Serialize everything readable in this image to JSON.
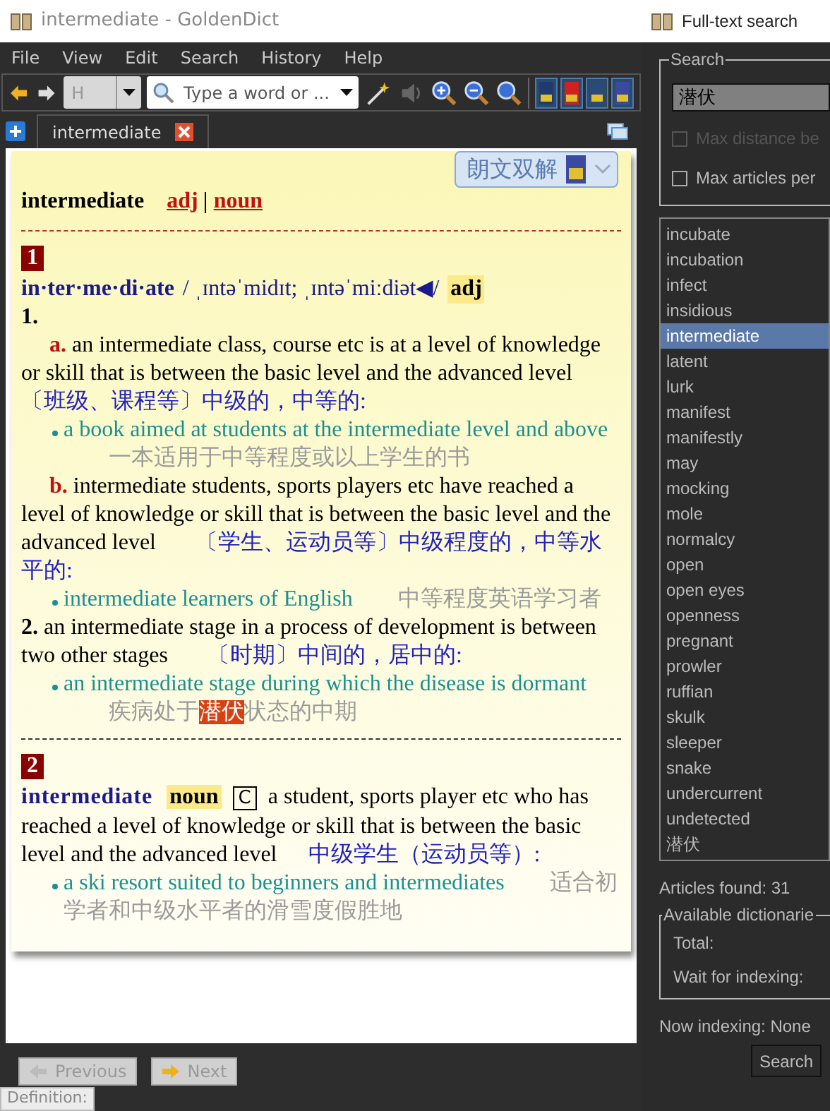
{
  "window": {
    "title": "intermediate - GoldenDict"
  },
  "menu": [
    "File",
    "View",
    "Edit",
    "Search",
    "History",
    "Help"
  ],
  "toolbar": {
    "history_field": "H",
    "search_placeholder": "Type a word or ...",
    "sound_disabled": true
  },
  "tabs": [
    {
      "label": "intermediate",
      "selected": true
    }
  ],
  "dictionary_bar": {
    "name": "朗文双解"
  },
  "article": {
    "headword": "intermediate",
    "pos_links": [
      "adj",
      "noun"
    ],
    "blocks": [
      {
        "kind": "entry",
        "number": "1",
        "headword": "in·ter·me·di·ate",
        "pron": "/ ˌɪntəˈmidɪt; ˌɪntəˈmiːdiət◀/",
        "pos": "adj",
        "senses": [
          {
            "kind": "lettered",
            "number": "1.",
            "parts": [
              {
                "letter": "a.",
                "text": "an intermediate class, course etc is at a level of knowledge or skill that is between the basic level and the advanced level",
                "translation": "〔班级、课程等〕中级的，中等的:",
                "example": {
                  "en": "a book aimed at students at the intermediate level and above",
                  "cn": [
                    {
                      "text": "一本适用于中等程度或以上学生的书",
                      "highlighted": false
                    }
                  ]
                }
              },
              {
                "letter": "b.",
                "text": "intermediate students, sports players etc have reached a level of knowledge or skill that is between the basic level and the advanced level",
                "translation": "〔学生、运动员等〕中级程度的，中等水平的:",
                "example": {
                  "en": "intermediate learners of English",
                  "cn": [
                    {
                      "text": "中等程度英语学习者",
                      "highlighted": false
                    }
                  ]
                }
              }
            ]
          },
          {
            "kind": "plain",
            "number": "2.",
            "parts": [
              {
                "text": "an intermediate stage in a process of development is between two other stages",
                "translation": "〔时期〕中间的，居中的:",
                "example": {
                  "en": "an intermediate stage during which the disease is dormant",
                  "cn": [
                    {
                      "text": "疾病处于",
                      "highlighted": false
                    },
                    {
                      "text": "潜伏",
                      "highlighted": true
                    },
                    {
                      "text": "状态的中期",
                      "highlighted": false
                    }
                  ]
                }
              }
            ]
          }
        ]
      },
      {
        "kind": "noun",
        "number": "2",
        "headword": "intermediate",
        "pos": "noun",
        "grammar": "C",
        "text": "a student, sports player etc who has reached a level of knowledge or skill that is between the basic level and the advanced level",
        "translation": "中级学生（运动员等）:",
        "example": {
          "en": "a ski resort suited to beginners and intermediates",
          "cn": [
            {
              "text": "适合初学者和中级水平者的滑雪度假胜地",
              "highlighted": false
            }
          ]
        }
      }
    ]
  },
  "nav_buttons": [
    {
      "label": "Previous",
      "disabled": true
    },
    {
      "label": "Next",
      "disabled": true
    }
  ],
  "tooltip": "Definition:",
  "fulltext": {
    "title": "Full-text search",
    "search_group": "Search",
    "query": "潜伏",
    "options": [
      {
        "label": "Max distance be",
        "checked": false,
        "disabled": true
      },
      {
        "label": "Max articles per",
        "checked": false,
        "disabled": false
      }
    ],
    "results": [
      {
        "label": "incubate",
        "selected": false
      },
      {
        "label": "incubation",
        "selected": false
      },
      {
        "label": "infect",
        "selected": false
      },
      {
        "label": "insidious",
        "selected": false
      },
      {
        "label": "intermediate",
        "selected": true
      },
      {
        "label": "latent",
        "selected": false
      },
      {
        "label": "lurk",
        "selected": false
      },
      {
        "label": "manifest",
        "selected": false
      },
      {
        "label": "manifestly",
        "selected": false
      },
      {
        "label": "may",
        "selected": false
      },
      {
        "label": "mocking",
        "selected": false
      },
      {
        "label": "mole",
        "selected": false
      },
      {
        "label": "normalcy",
        "selected": false
      },
      {
        "label": "open",
        "selected": false
      },
      {
        "label": "open eyes",
        "selected": false
      },
      {
        "label": "openness",
        "selected": false
      },
      {
        "label": "pregnant",
        "selected": false
      },
      {
        "label": "prowler",
        "selected": false
      },
      {
        "label": "ruffian",
        "selected": false
      },
      {
        "label": "skulk",
        "selected": false
      },
      {
        "label": "sleeper",
        "selected": false
      },
      {
        "label": "snake",
        "selected": false
      },
      {
        "label": "undercurrent",
        "selected": false
      },
      {
        "label": "undetected",
        "selected": false
      },
      {
        "label": "潜伏",
        "selected": false
      }
    ],
    "articles_found": "Articles found: 31",
    "dict_group": "Available dictionarie",
    "total": "Total:",
    "wait": "Wait for indexing:",
    "now_indexing": "Now indexing: None",
    "search_button": "Search"
  }
}
